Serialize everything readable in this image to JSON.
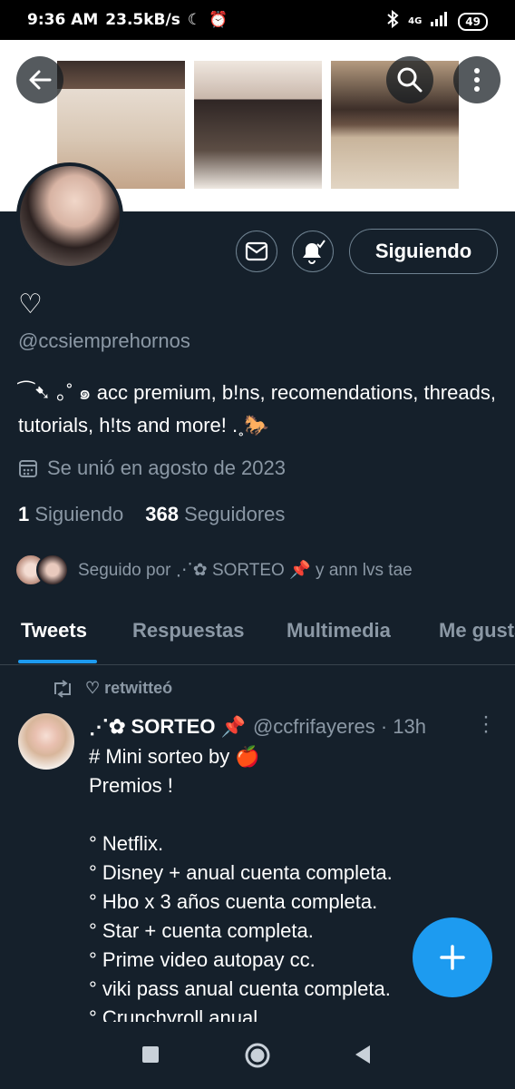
{
  "status_bar": {
    "time": "9:36 AM",
    "speed": "23.5kB/s",
    "network": "4G",
    "battery": "49"
  },
  "profile": {
    "name": "♡",
    "handle": "@ccsiemprehornos",
    "bio": "⁀➷ ｡˚ ๑ acc premium, b!ns, recomendations, threads, tutorials, h!ts and more! .˳🐎",
    "joined": "Se unió en agosto de 2023",
    "following_count": "1",
    "following_label": "Siguiendo",
    "followers_count": "368",
    "followers_label": "Seguidores",
    "followed_by": "Seguido por ⋰✿ SORTEO 📌 y ann lvs tae",
    "follow_button": "Siguiendo"
  },
  "tabs": [
    "Tweets",
    "Respuestas",
    "Multimedia",
    "Me gusta"
  ],
  "tweet": {
    "retweet_label": "♡ retwitteó",
    "author_name": "⋰✿ SORTEO 📌",
    "author_meta": "@ccfrifayeres · 13h",
    "text": "# Mini sorteo by 🍎\nPremios !\n\n° Netflix.\n° Disney + anual cuenta completa.\n° Hbo x 3 años cuenta completa.\n° Star + cuenta completa.\n° Prime video autopay cc.\n° viki pass anual cuenta completa.\n° Crunchyroll anual."
  },
  "colors": {
    "background": "#15202b",
    "accent": "#1d9bf0",
    "secondary_text": "#8b98a5",
    "border": "#38444d"
  },
  "icons": [
    "back-arrow-icon",
    "search-icon",
    "more-vertical-icon",
    "envelope-icon",
    "bell-check-icon",
    "calendar-icon",
    "retweet-icon",
    "compose-plus-icon",
    "nav-square-icon",
    "nav-circle-icon",
    "nav-back-triangle-icon"
  ]
}
